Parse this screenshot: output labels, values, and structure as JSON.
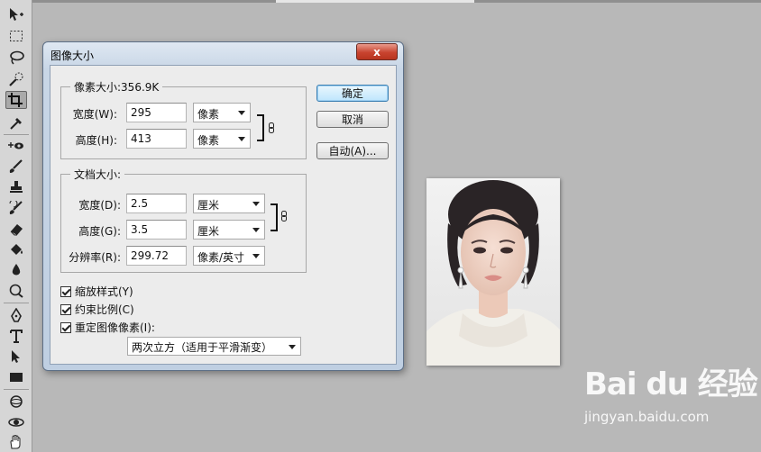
{
  "dialog": {
    "title": "图像大小",
    "close_label": "x",
    "pixel_dimensions": {
      "legend": "像素大小:356.9K",
      "width_label": "宽度(W):",
      "width_value": "295",
      "width_unit": "像素",
      "height_label": "高度(H):",
      "height_value": "413",
      "height_unit": "像素"
    },
    "document_size": {
      "legend": "文档大小:",
      "width_label": "宽度(D):",
      "width_value": "2.5",
      "width_unit": "厘米",
      "height_label": "高度(G):",
      "height_value": "3.5",
      "height_unit": "厘米",
      "resolution_label": "分辨率(R):",
      "resolution_value": "299.72",
      "resolution_unit": "像素/英寸"
    },
    "options": {
      "scale_styles": "缩放样式(Y)",
      "constrain_proportions": "约束比例(C)",
      "resample": "重定图像像素(I):",
      "resample_method": "两次立方（适用于平滑渐变）"
    },
    "buttons": {
      "ok": "确定",
      "cancel": "取消",
      "auto": "自动(A)..."
    }
  },
  "watermark": {
    "logo": "Bai du 经验",
    "url": "jingyan.baidu.com"
  },
  "colors": {
    "canvas_bg": "#b8b8b8",
    "toolbar_bg": "#d6d6d6",
    "close_red": "#c8432f",
    "title_blue": "#c8d6e6"
  },
  "toolbar": {
    "icons": [
      "move-icon",
      "marquee-icon",
      "lasso-icon",
      "quick-select-icon",
      "crop-icon",
      "eyedropper-icon",
      "spot-heal-icon",
      "brush-icon",
      "stamp-icon",
      "history-brush-icon",
      "eraser-icon",
      "bucket-icon",
      "blur-icon",
      "dodge-icon",
      "pen-icon",
      "type-icon",
      "path-select-icon",
      "rectangle-icon",
      "3d-rotate-icon",
      "3d-orbit-icon",
      "hand-icon"
    ]
  }
}
